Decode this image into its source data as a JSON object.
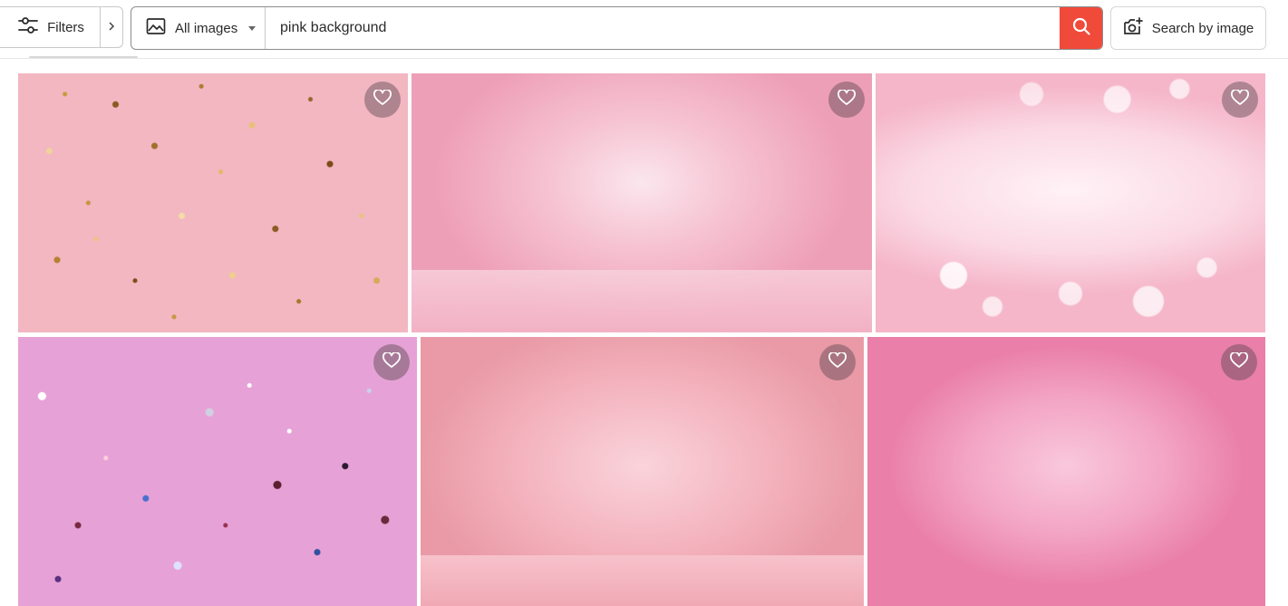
{
  "toolbar": {
    "filters_label": "Filters",
    "image_type_selected": "All images",
    "search_query": "pink background",
    "search_by_image_label": "Search by image"
  },
  "icons": {
    "filters": "sliders-icon",
    "expand": "chevron-right-icon",
    "image_type": "image-icon",
    "search": "search-icon",
    "camera": "camera-plus-icon",
    "favorite": "heart-icon"
  },
  "colors": {
    "search_button": "#f04a3a",
    "favorite_overlay": "#5a4650"
  },
  "results": [
    {
      "description": "gold confetti on pink"
    },
    {
      "description": "pink studio backdrop"
    },
    {
      "description": "pink bokeh lights"
    },
    {
      "description": "multicolor confetti on pink"
    },
    {
      "description": "peach pink studio backdrop"
    },
    {
      "description": "hot pink gradient"
    }
  ]
}
